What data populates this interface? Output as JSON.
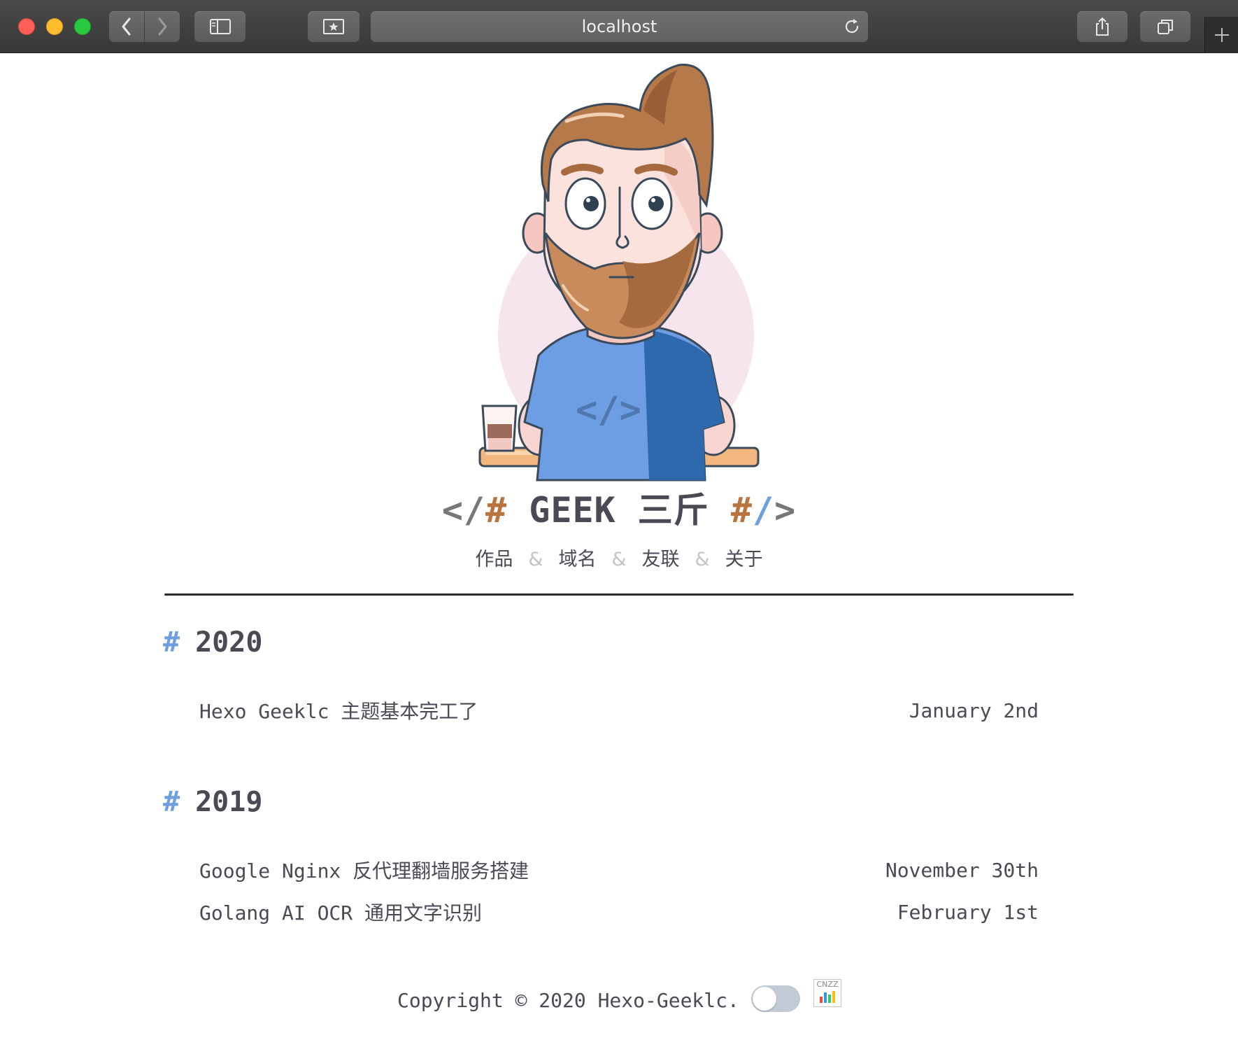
{
  "browser": {
    "url": "localhost"
  },
  "site": {
    "title_open_angle": "</",
    "title_open_hash": "#",
    "title_text": " GEEK 三斤 ",
    "title_close_hash": "#",
    "title_close_slash": "/",
    "title_close_angle": ">",
    "nav": [
      {
        "label": "作品"
      },
      {
        "label": "域名"
      },
      {
        "label": "友联"
      },
      {
        "label": "关于"
      }
    ],
    "nav_separator": "&"
  },
  "archive": {
    "hash": "#",
    "years": [
      {
        "year": "2020",
        "posts": [
          {
            "title": "Hexo Geeklc 主题基本完工了",
            "date": "January 2nd"
          }
        ]
      },
      {
        "year": "2019",
        "posts": [
          {
            "title": "Google Nginx 反代理翻墙服务搭建",
            "date": "November 30th"
          },
          {
            "title": "Golang AI OCR 通用文字识别",
            "date": "February 1st"
          }
        ]
      }
    ]
  },
  "footer": {
    "copyright": "Copyright © 2020 Hexo-Geeklc.",
    "badge_text": "CNZZ",
    "theme_toggle_on": false
  },
  "colors": {
    "accent_blue": "#6c9ee0",
    "accent_brown": "#b8733f",
    "text": "#4a4a55"
  }
}
